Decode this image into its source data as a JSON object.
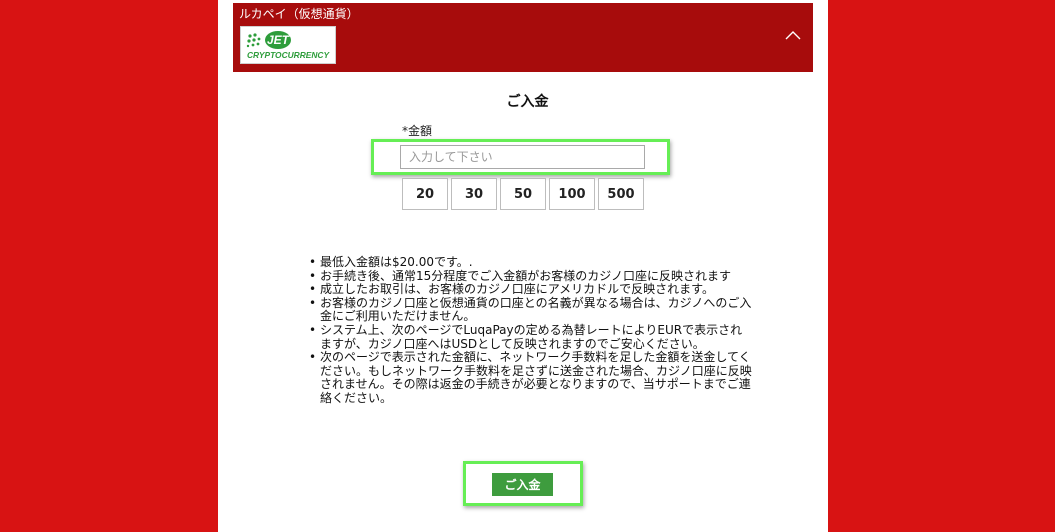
{
  "header": {
    "title": "ルカペイ（仮想通貨）",
    "logo_text_top": "JET",
    "logo_text_bottom": "CRYPTOCURRENCY"
  },
  "form": {
    "section_title": "ご入金",
    "amount_label": "*金額",
    "amount_value": "",
    "amount_placeholder": "入力して下さい",
    "presets": [
      "20",
      "30",
      "50",
      "100",
      "500"
    ]
  },
  "notes": [
    "最低入金額は$20.00です。.",
    "お手続き後、通常15分程度でご入金額がお客様のカジノ口座に反映されます",
    "成立したお取引は、お客様のカジノ口座にアメリカドルで反映されます。",
    "お客様のカジノ口座と仮想通貨の口座との名義が異なる場合は、カジノへのご入金にご利用いただけません。",
    "システム上、次のページでLuqaPayの定める為替レートによりEURで表示されますが、カジノ口座へはUSDとして反映されますのでご安心ください。",
    "次のページで表示された金額に、ネットワーク手数料を足した金額を送金してください。もしネットワーク手数料を足さずに送金された場合、カジノ口座に反映されません。その際は返金の手続きが必要となりますので、当サポートまでご連絡ください。"
  ],
  "submit": {
    "label": "ご入金"
  },
  "colors": {
    "page_background": "#d81313",
    "header_background": "#a70c0c",
    "highlight": "#66ee55",
    "submit_button": "#3e9c3e",
    "logo_green": "#2e9d3b"
  }
}
